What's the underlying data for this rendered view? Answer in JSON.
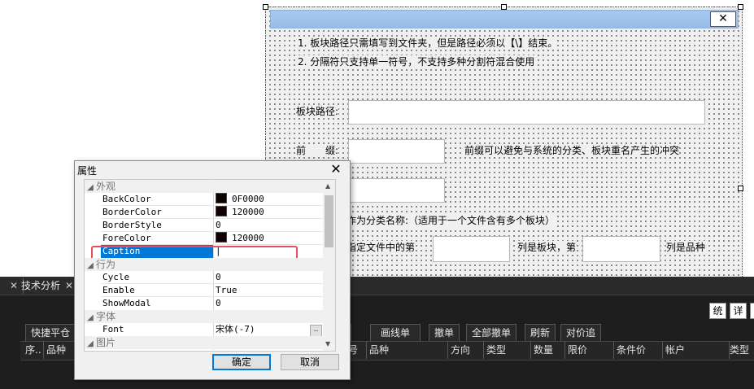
{
  "form": {
    "instructions": [
      "1. 板块路径只需填写到文件夹，但是路径必须以【\\】结束。",
      "2. 分隔符只支持单一符号，不支持多种分割符混合使用"
    ],
    "path_label": "板块路径:",
    "prefix_label": "前　　缀:",
    "prefix_hint": "前缀可以避免与系统的分类、板块重名产生的冲突",
    "category_name_text": "作为分类名称:（适用于一个文件含有多个板块）",
    "column_text_1": "指定文件中的第",
    "column_text_2": "列是板块，第",
    "column_text_3": "列是品种",
    "close_glyph": "✕"
  },
  "properties": {
    "title": "属性",
    "close_glyph": "✕",
    "categories": {
      "appearance": "外观",
      "behavior": "行为",
      "font": "字体",
      "picture": "图片"
    },
    "rows": [
      {
        "name": "BackColor",
        "value": "0F0000",
        "color": "#0f0000"
      },
      {
        "name": "BorderColor",
        "value": "120000",
        "color": "#120000"
      },
      {
        "name": "BorderStyle",
        "value": "0"
      },
      {
        "name": "ForeColor",
        "value": "120000",
        "color": "#120000"
      },
      {
        "name": "Caption",
        "value": "|"
      },
      {
        "name": "Cycle",
        "value": "0"
      },
      {
        "name": "Enable",
        "value": "True"
      },
      {
        "name": "ShowModal",
        "value": "0"
      },
      {
        "name": "Font",
        "value": "宋体(-7)"
      }
    ],
    "ok_label": "确定",
    "cancel_label": "取消",
    "ellipsis": ".."
  },
  "trading": {
    "tabs": [
      {
        "label": "",
        "close": "✕"
      },
      {
        "label": "技术分析",
        "close": "✕"
      }
    ],
    "side_buttons": [
      "统",
      "详"
    ],
    "toolbar": [
      "快捷平仓",
      "画线单",
      "撤单",
      "全部撤单",
      "刷新",
      "对价追"
    ],
    "left_columns": [
      "序..",
      "品种"
    ],
    "right_columns": [
      "号",
      "品种",
      "方向",
      "类型",
      "数量",
      "限价",
      "条件价",
      "帐户",
      "类型"
    ]
  },
  "colors": {
    "accent": "#0078d7",
    "highlight_border": "#e05060",
    "dark_bg": "#1e1e1e",
    "title_gradient": "#a8c8ee"
  }
}
